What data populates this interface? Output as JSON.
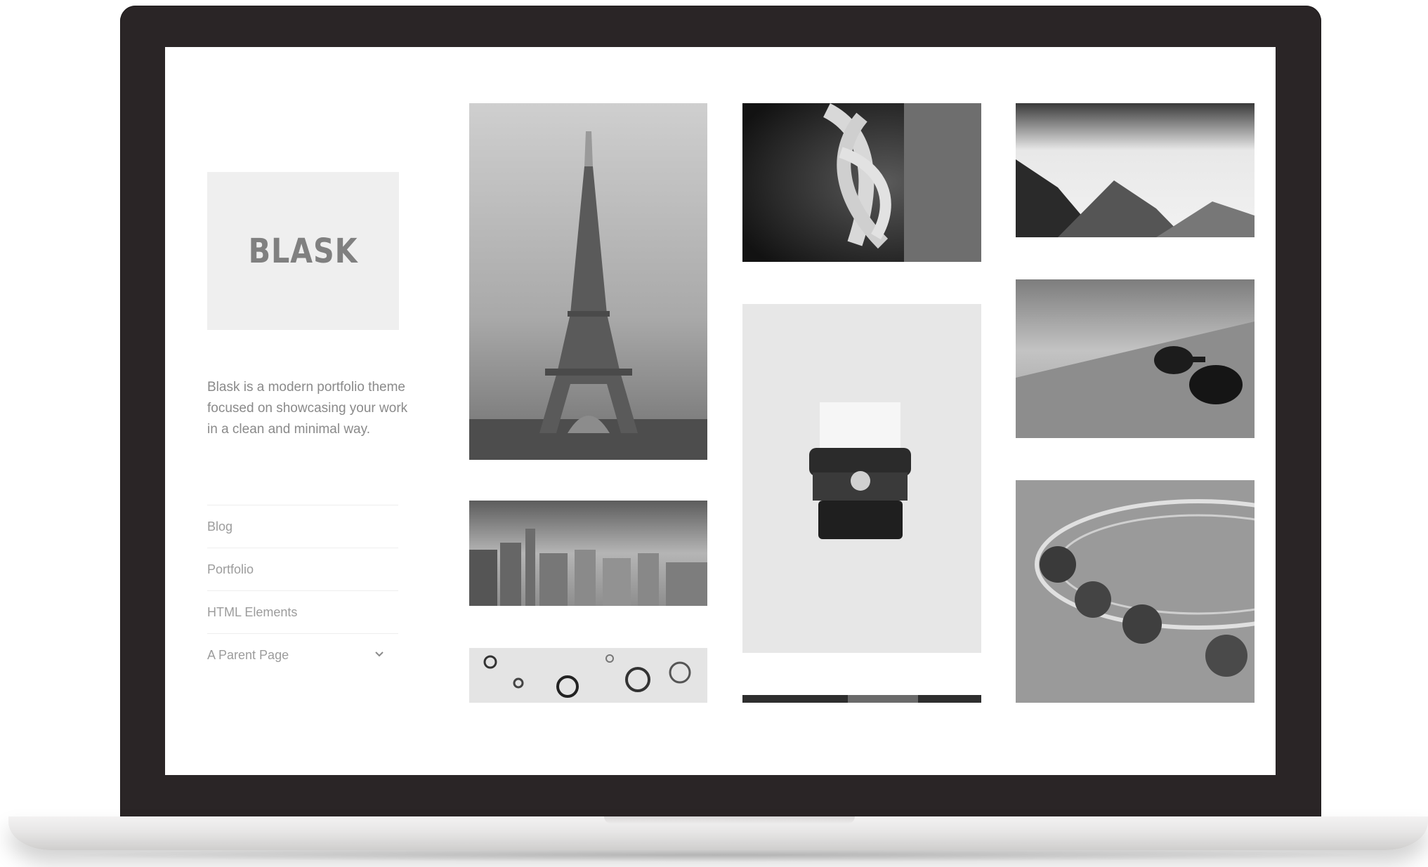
{
  "site": {
    "logo_text": "BLASK",
    "description": "Blask is a modern portfolio theme focused on showcasing your work in a clean and minimal way."
  },
  "nav": {
    "items": [
      {
        "label": "Blog"
      },
      {
        "label": "Portfolio"
      },
      {
        "label": "HTML Elements"
      },
      {
        "label": "A Parent Page"
      }
    ]
  },
  "gallery": {
    "tiles": [
      {
        "subject": "eiffel-tower-photo"
      },
      {
        "subject": "city-skyline-photo"
      },
      {
        "subject": "water-drops-photo"
      },
      {
        "subject": "rope-knot-photo"
      },
      {
        "subject": "typewriter-photo"
      },
      {
        "subject": "dark-partial-photo"
      },
      {
        "subject": "misty-forest-photo"
      },
      {
        "subject": "sunglasses-photo"
      },
      {
        "subject": "ferris-wheel-photo"
      }
    ]
  },
  "colors": {
    "bezel": "#2a2526",
    "logo_box": "#efefef",
    "logo_text": "#808080",
    "body_text": "#8a8a8a",
    "nav_text": "#9c9c9c"
  }
}
